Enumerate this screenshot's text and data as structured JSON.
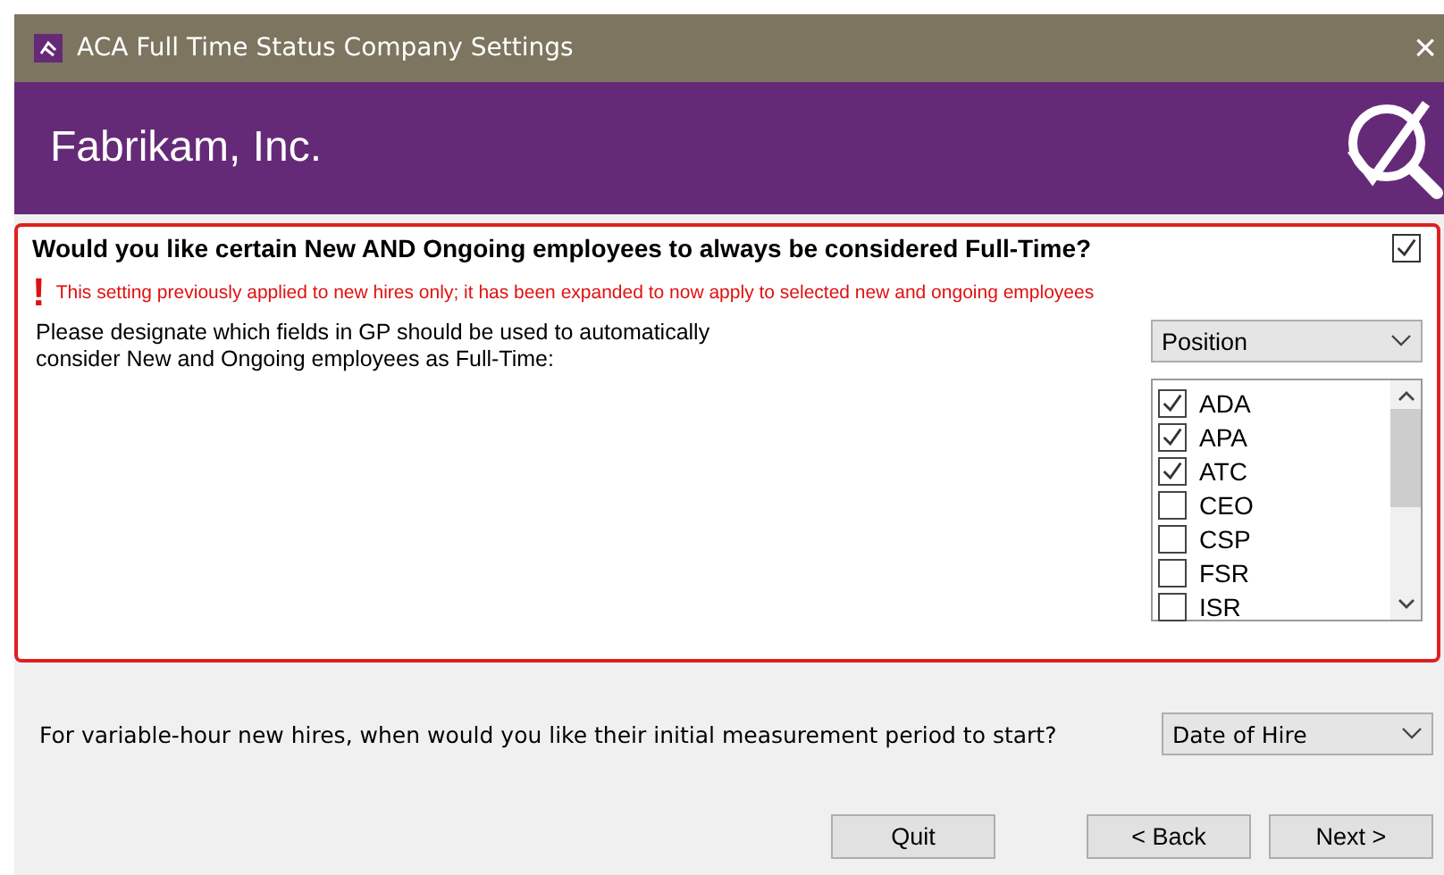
{
  "window": {
    "title": "ACA Full Time Status Company Settings",
    "close": "×"
  },
  "header": {
    "company": "Fabrikam, Inc."
  },
  "full_time_section": {
    "question": "Would you like certain New AND Ongoing employees to always be considered Full-Time?",
    "checked": true,
    "warning_mark": "!",
    "warning": "This setting previously applied to new hires only; it has been expanded to now apply to selected new and ongoing employees",
    "fields_prompt": "Please designate which fields in GP should be used to automatically consider New and Ongoing employees as Full-Time:",
    "field_dropdown": "Position",
    "items": [
      {
        "label": "ADA",
        "checked": true
      },
      {
        "label": "APA",
        "checked": true
      },
      {
        "label": "ATC",
        "checked": true
      },
      {
        "label": "CEO",
        "checked": false
      },
      {
        "label": "CSP",
        "checked": false
      },
      {
        "label": "FSR",
        "checked": false
      },
      {
        "label": "ISR",
        "checked": false
      }
    ]
  },
  "measurement": {
    "question": "For variable-hour new hires, when would you like their initial measurement period to start?",
    "dropdown": "Date of Hire"
  },
  "buttons": [
    {
      "label": "Quit",
      "kind": "quit"
    },
    {
      "label": "< Back",
      "kind": "nav"
    },
    {
      "label": "Next >",
      "kind": "nav"
    }
  ]
}
